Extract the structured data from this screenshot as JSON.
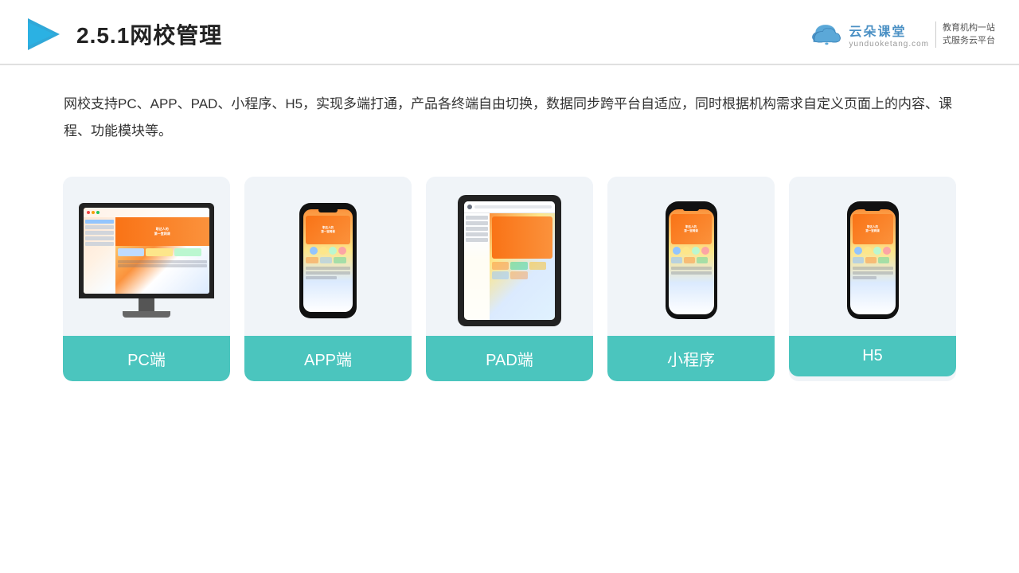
{
  "header": {
    "title": "2.5.1网校管理",
    "brand_name": "云朵课堂",
    "brand_url": "yunduoketang.com",
    "brand_slogan_line1": "教育机构一站",
    "brand_slogan_line2": "式服务云平台"
  },
  "description": {
    "text": "网校支持PC、APP、PAD、小程序、H5，实现多端打通，产品各终端自由切换，数据同步跨平台自适应，同时根据机构需求自定义页面上的内容、课程、功能模块等。"
  },
  "cards": [
    {
      "label": "PC端",
      "type": "pc"
    },
    {
      "label": "APP端",
      "type": "phone"
    },
    {
      "label": "PAD端",
      "type": "tablet"
    },
    {
      "label": "小程序",
      "type": "phone-thin"
    },
    {
      "label": "H5",
      "type": "phone-thin2"
    }
  ]
}
